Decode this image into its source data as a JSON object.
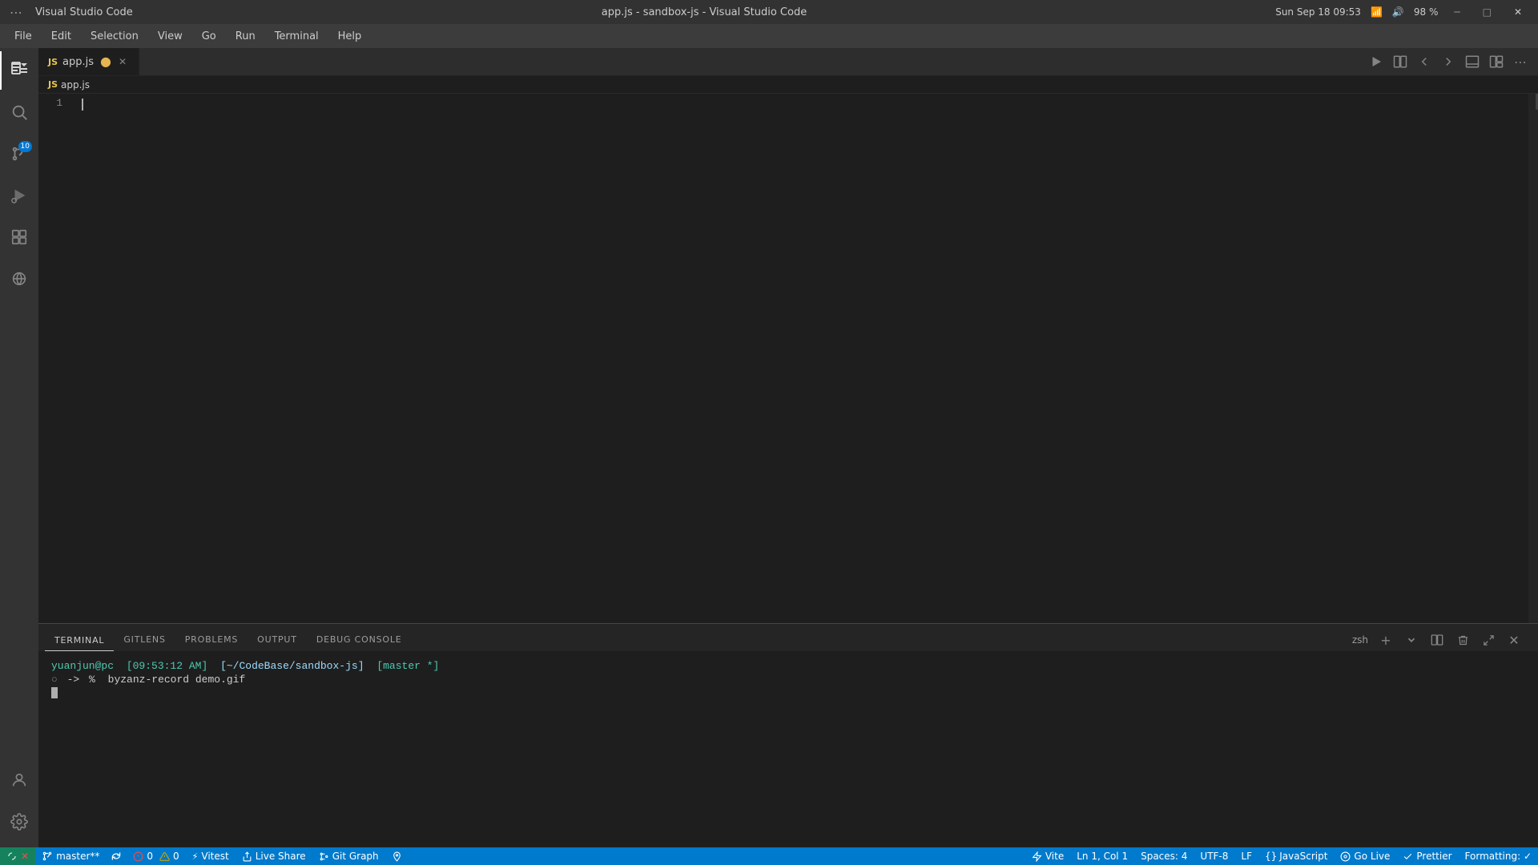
{
  "window": {
    "title": "Visual Studio Code",
    "file_title": "app.js - sandbox-js - Visual Studio Code",
    "datetime": "Sun Sep 18  09:53",
    "battery": "98 %"
  },
  "menu": {
    "items": [
      "File",
      "Edit",
      "Selection",
      "View",
      "Go",
      "Run",
      "Terminal",
      "Help"
    ]
  },
  "activity_bar": {
    "icons": [
      {
        "name": "explorer",
        "symbol": "⎗",
        "active": true,
        "badge": null
      },
      {
        "name": "search",
        "symbol": "🔍",
        "active": false,
        "badge": null
      },
      {
        "name": "source-control",
        "symbol": "⑃",
        "active": false,
        "badge": "10"
      },
      {
        "name": "run-debug",
        "symbol": "▷",
        "active": false,
        "badge": null
      },
      {
        "name": "extensions",
        "symbol": "⊞",
        "active": false,
        "badge": null
      },
      {
        "name": "remote-explorer",
        "symbol": "⊙",
        "active": false,
        "badge": null
      }
    ],
    "bottom_icons": [
      {
        "name": "accounts",
        "symbol": "👤"
      },
      {
        "name": "settings",
        "symbol": "⚙"
      }
    ]
  },
  "tabs": {
    "items": [
      {
        "label": "app.js",
        "type": "JS",
        "modified": true,
        "active": true
      }
    ]
  },
  "toolbar": {
    "run_label": "▷",
    "split_label": "⧉",
    "back_label": "←",
    "forward_label": "→",
    "more_label": "⋯"
  },
  "breadcrumb": {
    "text": "app.js"
  },
  "editor": {
    "lines": [
      {
        "number": "1",
        "content": ""
      }
    ]
  },
  "terminal": {
    "tabs": [
      "TERMINAL",
      "GITLENS",
      "PROBLEMS",
      "OUTPUT",
      "DEBUG CONSOLE"
    ],
    "active_tab": "TERMINAL",
    "shell": "zsh",
    "prompt_user": "yuanjun@pc",
    "prompt_time": "[09:53:12 AM]",
    "prompt_path": "[~/CodeBase/sandbox-js]",
    "prompt_git": "[master *]",
    "command": "byzanz-record demo.gif"
  },
  "status_bar": {
    "remote": "master**",
    "sync_icon": "↻",
    "errors": "0",
    "warnings": "0",
    "vitest": "Vitest",
    "live_share": "Live Share",
    "git_graph": "Git Graph",
    "port": "⚓",
    "vite": "Vite",
    "position": "Ln 1, Col 1",
    "spaces": "Spaces: 4",
    "encoding": "UTF-8",
    "line_ending": "LF",
    "language": "JavaScript",
    "go_live": "Go Live",
    "prettier": "Prettier",
    "formatting": "Formatting: ✓"
  }
}
